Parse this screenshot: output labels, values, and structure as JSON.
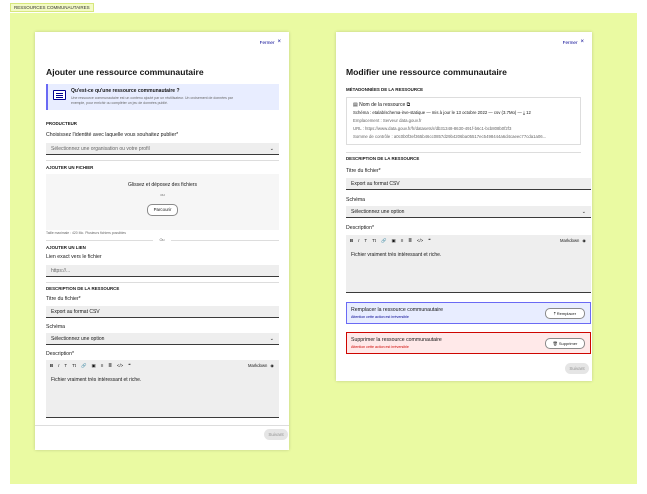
{
  "frame_tag": "RESSOURCES COMMUNAUTAIRES",
  "left": {
    "close_label": "Fermer",
    "title": "Ajouter une ressource communautaire",
    "callout": {
      "title": "Qu'est-ce qu'une ressource communautaire ?",
      "text_1": "Une ressource communautaire est un contenu ajouté par un réutilisateur. Un croisement de données par",
      "text_2": "exemple, pour enrichir ou compléter un jeu de données publié."
    },
    "producer": {
      "section": "Producteur",
      "label": "Choisissez l'identité avec laquelle vous souhaitez publier*",
      "placeholder": "Sélectionnez une organisation ou votre profil"
    },
    "file": {
      "section": "Ajouter un fichier",
      "drop_title": "Glissez et déposez des fichiers",
      "or_small": "ou",
      "browse": "Parcourir",
      "hint": "Taille maximale : 420 Mo. Plusieurs fichiers possibles",
      "or_sep": "Ou"
    },
    "link": {
      "section": "Ajouter un lien",
      "label": "Lien exact vers le fichier",
      "placeholder": "https://..."
    },
    "description": {
      "section": "Description de la ressource",
      "title_label": "Titre du fichier*",
      "title_value": "Export au format CSV",
      "schema_label": "Schéma",
      "schema_value": "Sélectionnez une option",
      "desc_label": "Description*",
      "toolbar": [
        "B",
        "I",
        "T",
        "Tt",
        "🔗",
        "▣",
        "≡",
        "≣",
        "</>",
        "❝"
      ],
      "markdown": "Markdown",
      "desc_value": "Fichier vraiment très intéressant et riche."
    },
    "submit": "Suivant"
  },
  "right": {
    "close_label": "Fermer",
    "title": "Modifier une ressource communautaire",
    "metadata": {
      "section": "Métadonnées de la ressource",
      "name_label": "Nom de la ressource",
      "schema_line": "Schéma : etalab/schema-irve-statique  —  mis à jour le 13 octobre 2022  —  csv (3.7Mo)  —  ⤓ 12",
      "location_line": "Emplacement : Serveur data.gouv.fr",
      "url_line": "URL : https://www.data.gouv.fr/fr/datasets/r/db31348-8630-491f-b6c1-bcb808b0f2f3",
      "checksum_line": "Somme de contrôle : a0c0b0f3ef365b46cc0857d29b4206ba05517ec5498444a6d4caeec77cda1a06..."
    },
    "description": {
      "section": "Description de la ressource",
      "title_label": "Titre du fichier*",
      "title_value": "Export au format CSV",
      "schema_label": "Schéma",
      "schema_value": "Sélectionnez une option",
      "desc_label": "Description*",
      "toolbar": [
        "B",
        "I",
        "T",
        "Tt",
        "🔗",
        "▣",
        "≡",
        "≣",
        "</>",
        "❝"
      ],
      "markdown": "Markdown",
      "desc_value": "Fichier vraiment très intéressant et riche."
    },
    "replace": {
      "title": "Remplacer la ressource communautaire",
      "sub": "Attention cette action est irréversible",
      "button": "⤒ Remplacer"
    },
    "delete": {
      "title": "Supprimer la ressource communautaire",
      "sub": "Attention cette action est irréversible",
      "button": "🗑 Supprimer"
    },
    "submit": "Suivant"
  },
  "colors": {
    "canvas": "#eafaa2",
    "primary": "#000091",
    "callout_bg": "#e8edff",
    "danger": "#ce0500",
    "danger_bg": "#ffe9e9"
  }
}
